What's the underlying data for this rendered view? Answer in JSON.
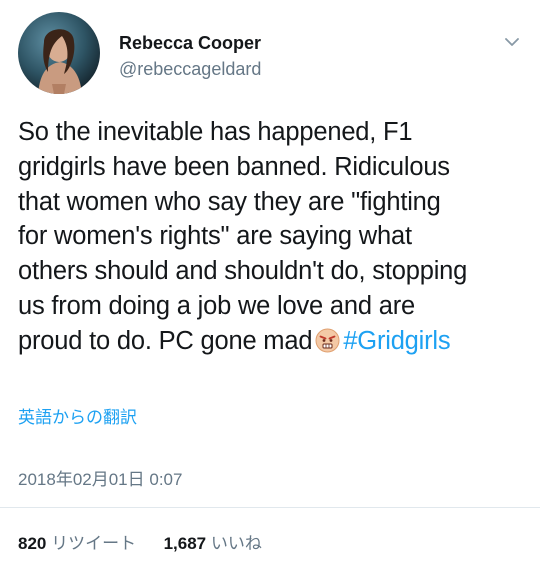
{
  "user": {
    "name": "Rebecca Cooper",
    "handle": "@rebeccageldard"
  },
  "tweet": {
    "text_lines": [
      "So the inevitable has happened, F1",
      "gridgirls have been banned. Ridiculous",
      "that women who say they are \"fighting",
      "for women's rights\" are saying what",
      "others should and shouldn't do, stopping",
      "us from doing a job we love and are",
      "proud to do. PC gone mad"
    ],
    "emoji": "angry-face-emoji",
    "hashtag": "#Gridgirls"
  },
  "translate_label": "英語からの翻訳",
  "timestamp": "2018年02月01日 0:07",
  "stats": {
    "retweets_count": "820",
    "retweets_label": "リツイート",
    "likes_count": "1,687",
    "likes_label": "いいね"
  },
  "colors": {
    "link": "#1da1f2",
    "secondary_text": "#657786",
    "primary_text": "#14171a"
  }
}
